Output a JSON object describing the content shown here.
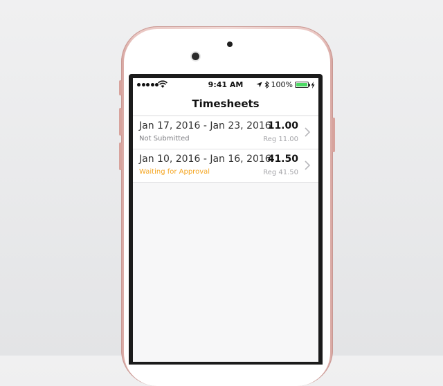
{
  "status_bar": {
    "time": "9:41 AM",
    "battery_text": "100%",
    "battery_level": 1.0,
    "icons": [
      "signal-dots",
      "wifi-icon",
      "location-icon",
      "bluetooth-icon",
      "battery-icon",
      "charging-icon"
    ]
  },
  "nav": {
    "title": "Timesheets"
  },
  "timesheets": [
    {
      "date_range": "Jan 17, 2016 - Jan 23, 2016",
      "status": "Not Submitted",
      "status_color": "#7d7d82",
      "total": "11.00",
      "regular": "Reg 11.00"
    },
    {
      "date_range": "Jan 10, 2016 - Jan 16, 2016",
      "status": "Waiting for Approval",
      "status_color": "#f5a623",
      "total": "41.50",
      "regular": "Reg 41.50"
    }
  ],
  "colors": {
    "phone_body": "#e9c6c2",
    "screen_background": "#f7f7f8",
    "battery_fill": "#4cd964"
  }
}
